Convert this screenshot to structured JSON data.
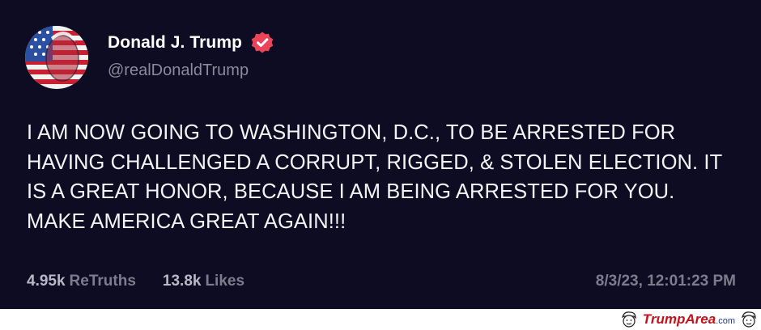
{
  "post": {
    "author_name": "Donald J. Trump",
    "author_handle": "@realDonaldTrump",
    "text": "I AM NOW GOING TO WASHINGTON, D.C., TO BE ARRESTED FOR HAVING CHALLENGED A CORRUPT, RIGGED, & STOLEN ELECTION. IT IS A GREAT HONOR, BECAUSE I AM BEING ARRESTED FOR YOU. MAKE AMERICA GREAT AGAIN!!!",
    "retruths_count": "4.95k",
    "retruths_label": "ReTruths",
    "likes_count": "13.8k",
    "likes_label": "Likes",
    "timestamp": "8/3/23, 12:01:23 PM",
    "verified_icon": "verified-badge-icon",
    "verified_color": "#e9445a",
    "background_color": "#0e0c22"
  },
  "watermark": {
    "brand": "TrumpArea",
    "suffix": ".com",
    "icon": "cartoon-face-icon"
  }
}
